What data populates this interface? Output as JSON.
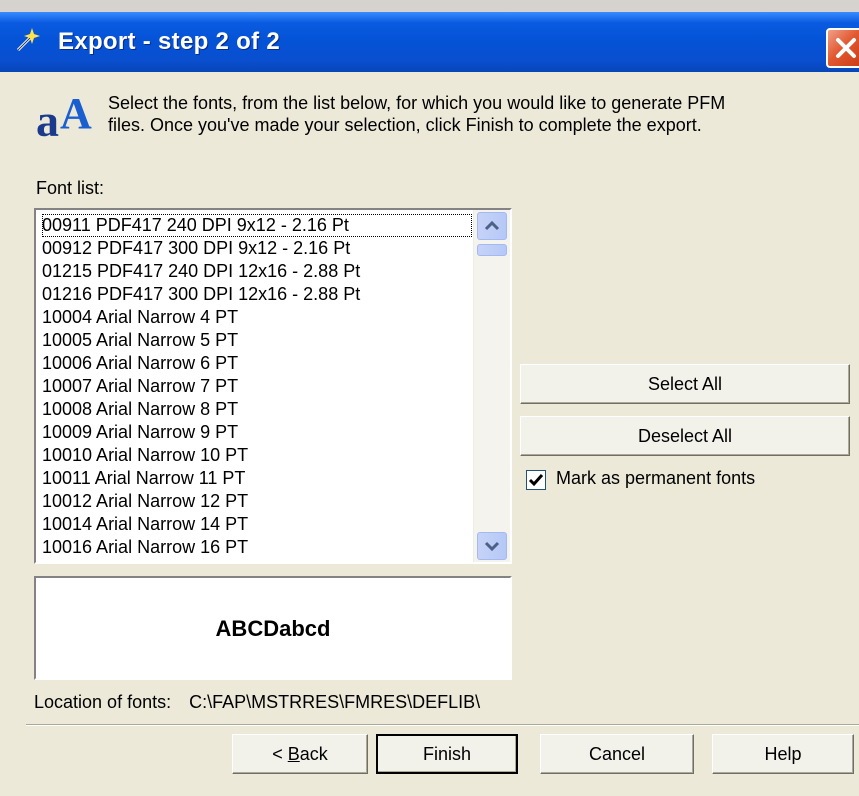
{
  "window": {
    "title": "Export - step 2 of 2"
  },
  "instructions": {
    "line1": "Select the fonts, from the list below, for which you would like to generate PFM",
    "line2": "files.  Once you've made your selection, click Finish to complete the export."
  },
  "font_list": {
    "label": "Font list:",
    "items": [
      "00911  PDF417 240 DPI 9x12 - 2.16 Pt",
      "00912  PDF417 300 DPI 9x12 - 2.16 Pt",
      "01215  PDF417 240 DPI 12x16 - 2.88 Pt",
      "01216  PDF417 300 DPI 12x16 - 2.88 Pt",
      "10004  Arial Narrow 4 PT",
      "10005  Arial Narrow 5 PT",
      "10006  Arial Narrow 6 PT",
      "10007  Arial Narrow 7 PT",
      "10008  Arial Narrow 8 PT",
      "10009  Arial Narrow 9 PT",
      "10010  Arial Narrow 10 PT",
      "10011  Arial Narrow 11 PT",
      "10012  Arial Narrow 12 PT",
      "10014  Arial Narrow 14 PT",
      "10016  Arial Narrow 16 PT"
    ]
  },
  "preview": {
    "text": "ABCDabcd"
  },
  "buttons": {
    "select_all": "Select All",
    "deselect_all": "Deselect All",
    "back_prefix": "< ",
    "back_mnemonic": "B",
    "back_rest": "ack",
    "finish": "Finish",
    "cancel": "Cancel",
    "help": "Help"
  },
  "checkbox": {
    "label": "Mark as permanent fonts",
    "checked": true
  },
  "location": {
    "label": "Location of fonts:",
    "path": "C:\\FAP\\MSTRRES\\FMRES\\DEFLIB\\"
  },
  "colors": {
    "titlebar": "#0452d6",
    "dialog_bg": "#ece9d8",
    "close_button": "#e2582f"
  }
}
